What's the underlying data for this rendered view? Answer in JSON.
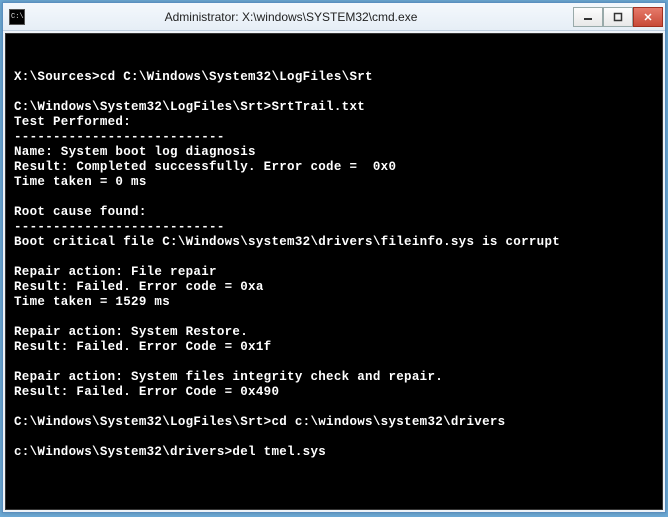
{
  "window": {
    "title": "Administrator: X:\\windows\\SYSTEM32\\cmd.exe",
    "icon_label": "C:\\"
  },
  "console": {
    "lines": [
      "X:\\Sources>cd C:\\Windows\\System32\\LogFiles\\Srt",
      "",
      "C:\\Windows\\System32\\LogFiles\\Srt>SrtTrail.txt",
      "Test Performed:",
      "---------------------------",
      "Name: System boot log diagnosis",
      "Result: Completed successfully. Error code =  0x0",
      "Time taken = 0 ms",
      "",
      "Root cause found:",
      "---------------------------",
      "Boot critical file C:\\Windows\\system32\\drivers\\fileinfo.sys is corrupt",
      "",
      "Repair action: File repair",
      "Result: Failed. Error code = 0xa",
      "Time taken = 1529 ms",
      "",
      "Repair action: System Restore.",
      "Result: Failed. Error Code = 0x1f",
      "",
      "Repair action: System files integrity check and repair.",
      "Result: Failed. Error Code = 0x490",
      "",
      "C:\\Windows\\System32\\LogFiles\\Srt>cd c:\\windows\\system32\\drivers",
      "",
      "c:\\Windows\\System32\\drivers>del tmel.sys"
    ],
    "current_prompt": ""
  }
}
